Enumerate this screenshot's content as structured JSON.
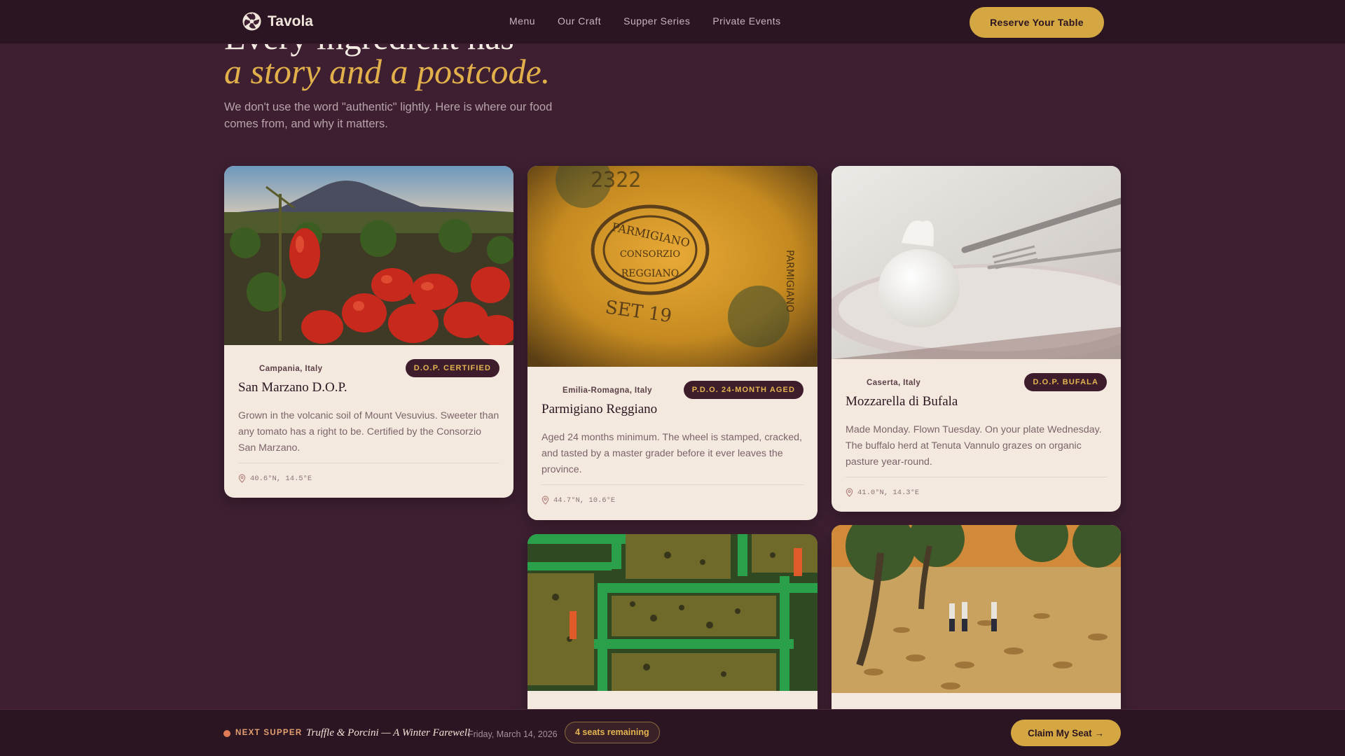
{
  "brand": {
    "name": "Tavola"
  },
  "nav": {
    "links": [
      "Menu",
      "Our Craft",
      "Supper Series",
      "Private Events"
    ],
    "cta": "Reserve Your Table"
  },
  "hero": {
    "line1": "Every ingredient has",
    "line2": "a story and a postcode.",
    "subtitle": "We don't use the word \"authentic\" lightly. Here is where our food comes from, and why it matters."
  },
  "ingredients": [
    {
      "region": "Campania, Italy",
      "badge": "D.O.P. CERTIFIED",
      "name": "San Marzano D.O.P.",
      "description": "Grown in the volcanic soil of Mount Vesuvius. Sweeter than any tomato has a right to be. Certified by the Consorzio San Marzano.",
      "coords": "40.6°N, 14.5°E",
      "image": "tomato-field-vesuvius"
    },
    {
      "region": "Emilia-Romagna, Italy",
      "badge": "P.D.O. 24-MONTH AGED",
      "name": "Parmigiano Reggiano",
      "description": "Aged 24 months minimum. The wheel is stamped, cracked, and tasted by a master grader before it ever leaves the province.",
      "coords": "44.7°N, 10.6°E",
      "image": "parmigiano-wheel-stamp"
    },
    {
      "region": "Caserta, Italy",
      "badge": "D.O.P. BUFALA",
      "name": "Mozzarella di Bufala",
      "description": "Made Monday. Flown Tuesday. On your plate Wednesday. The buffalo herd at Tenuta Vannulo grazes on organic pasture year-round.",
      "coords": "41.0°N, 14.3°E",
      "image": "burrata-plate"
    },
    {
      "image": "olive-crates"
    },
    {
      "image": "olive-grove-harvest"
    }
  ],
  "next_supper": {
    "label": "NEXT SUPPER",
    "title": "Truffle & Porcini — A Winter Farewell",
    "date": "Friday, March 14, 2026",
    "seats": "4 seats remaining",
    "cta": "Claim My Seat →"
  },
  "colors": {
    "background": "#3d1f31",
    "accent": "#d4a742",
    "nav": "#2c1522",
    "card": "#f4e9df"
  }
}
